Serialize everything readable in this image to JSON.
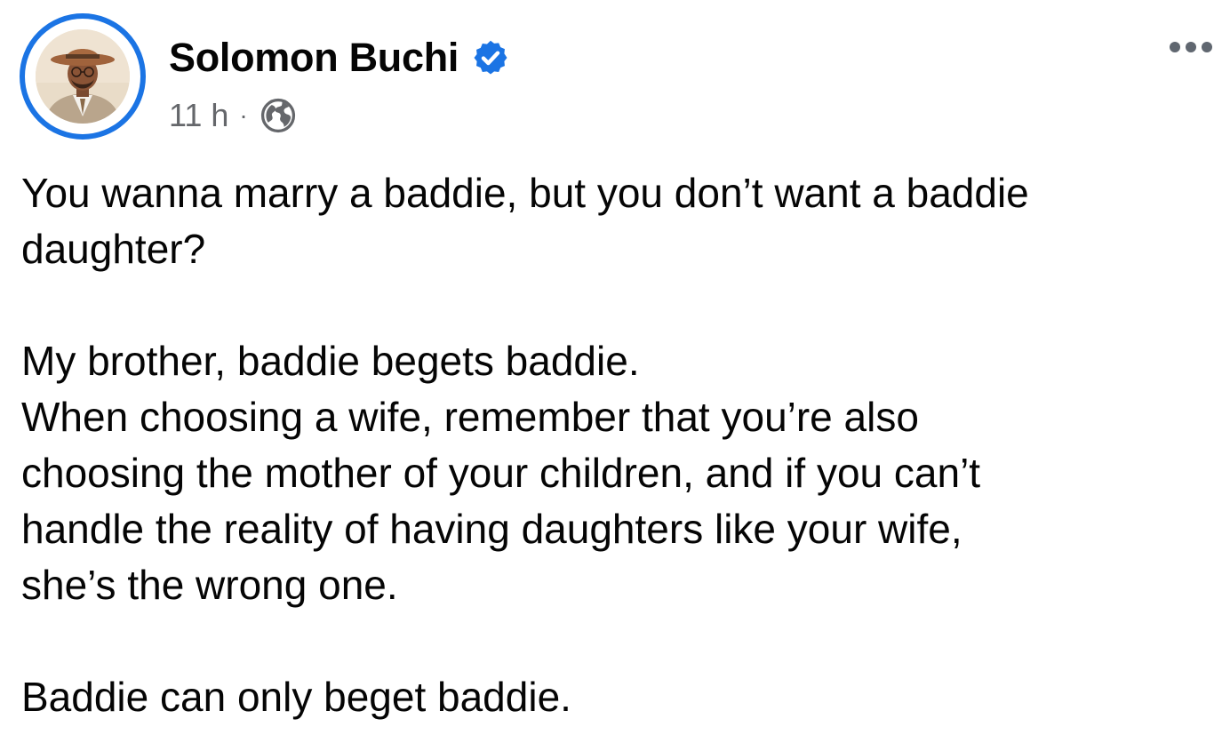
{
  "post": {
    "author": {
      "name": "Solomon Buchi",
      "verified": true,
      "avatar_icon": "profile-photo-man-in-hat"
    },
    "meta": {
      "timestamp": "11 h",
      "separator": "·",
      "audience_icon": "globe-icon"
    },
    "more_icon": "more-horizontal-icon",
    "paragraphs": [
      "You wanna marry a baddie, but you don’t want a baddie\ndaughter?",
      "My brother, baddie begets baddie.\nWhen choosing a wife, remember that you’re also\nchoosing the mother of your children, and if you can’t\nhandle the reality of having daughters like your wife,\nshe’s the wrong one.",
      "Baddie can only beget baddie."
    ]
  },
  "colors": {
    "accent": "#1b74e4",
    "text_primary": "#050505",
    "text_secondary": "#65676b",
    "background": "#ffffff"
  }
}
